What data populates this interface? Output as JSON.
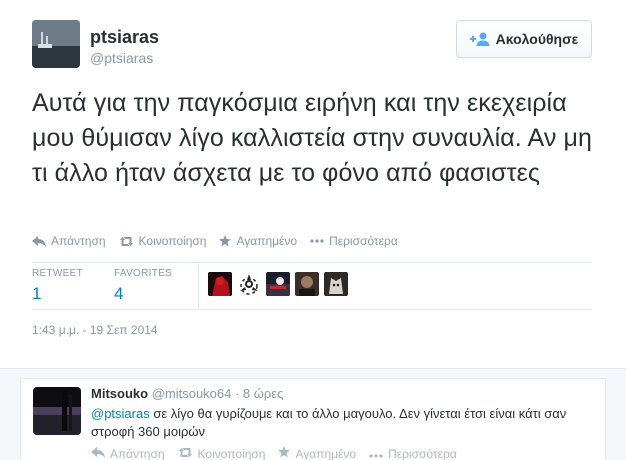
{
  "tweet": {
    "display_name": "ptsiaras",
    "screen_name": "@ptsiaras",
    "follow_label": "Ακολούθησε",
    "text": "Αυτά για την παγκόσμια ειρήνη και την εκεχειρία μου θύμισαν λίγο καλλιστεία στην συναυλία. Αν μη τι άλλο ήταν άσχετα με το φόνο από φασιστες",
    "actions": {
      "reply": "Απάντηση",
      "retweet": "Κοινοποίηση",
      "favorite": "Αγαπημένο",
      "more": "Περισσότερα"
    },
    "stats": {
      "retweets_label": "RETWEET",
      "retweets_value": "1",
      "favorites_label": "FAVORITES",
      "favorites_value": "4"
    },
    "timestamp": "1:43 μ.μ. - 19 Σεπ 2014"
  },
  "reply": {
    "display_name": "Mitsouko",
    "meta": "@mitsouko64 · 8 ώρες",
    "mention": "@ptsiaras",
    "text": " σε λίγο θα γυρίζουμε και το άλλο μαγουλο. Δεν γίνεται έτσι είναι κάτι σαν στροφή 360 μοιρών",
    "actions": {
      "reply": "Απάντηση",
      "retweet": "Κοινοποίηση",
      "favorite": "Αγαπημένο",
      "more": "Περισσότερα"
    }
  },
  "colors": {
    "link": "#0084b4",
    "muted": "#8899a6",
    "text": "#292f33",
    "border": "#e1e8ed"
  },
  "icons": [
    "follow-person-icon",
    "reply-icon",
    "retweet-icon",
    "star-icon",
    "more-dots-icon"
  ]
}
